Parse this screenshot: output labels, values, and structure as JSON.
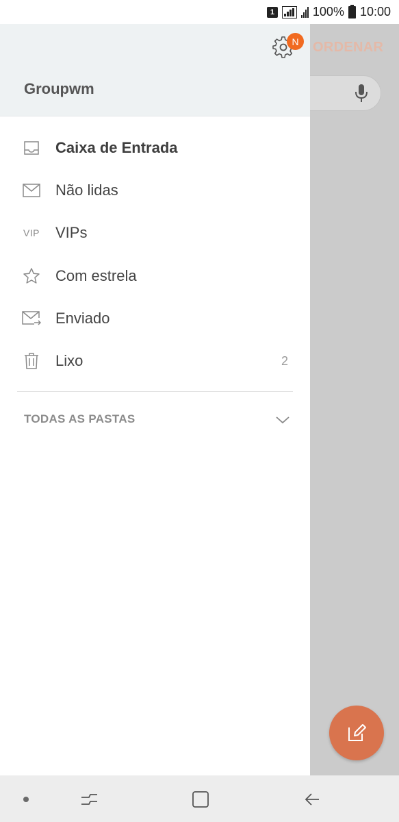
{
  "status_bar": {
    "sim_label": "1",
    "battery_percent": "100%",
    "time": "10:00"
  },
  "background_screen": {
    "sort_label": "ORDENAR",
    "compose_fab_icon": "compose-icon"
  },
  "drawer": {
    "account_name": "Groupwm",
    "settings_icon": "gear-icon",
    "settings_badge": "N",
    "folders": [
      {
        "label": "Caixa de Entrada",
        "icon": "inbox-icon",
        "count": "",
        "selected": true
      },
      {
        "label": "Não lidas",
        "icon": "envelope-icon",
        "count": ""
      },
      {
        "label": "VIPs",
        "icon": "vip-icon",
        "icon_text": "VIP",
        "count": ""
      },
      {
        "label": "Com estrela",
        "icon": "star-icon",
        "count": ""
      },
      {
        "label": "Enviado",
        "icon": "sent-icon",
        "count": ""
      },
      {
        "label": "Lixo",
        "icon": "trash-icon",
        "count": "2"
      }
    ],
    "all_folders_label": "TODAS AS PASTAS"
  },
  "colors": {
    "accent": "#d9744e",
    "badge": "#f16a20",
    "header_bg": "#eef2f3",
    "scrim": "#cbcbcb"
  }
}
